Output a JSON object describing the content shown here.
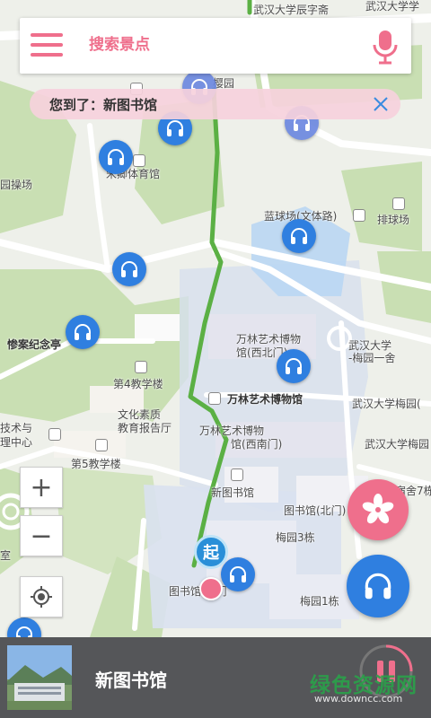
{
  "search": {
    "placeholder": "搜索景点"
  },
  "banner": {
    "text": "您到了：新图书馆"
  },
  "map": {
    "labels": {
      "top1": "武汉大学辰字斋",
      "top2": "武汉大学学",
      "yuan": "樱园",
      "tiyu": "宋卿体育馆",
      "caochang": "园操场",
      "lanqiu": "蓝球场(文体路)",
      "paiqiu": "排球场",
      "jinian": "惨案纪念亭",
      "wanlin1": "万林艺术博物",
      "wanlin1b": "馆(西北门)",
      "wanlin2": "万林艺术博物馆",
      "wanlin3": "万林艺术博物",
      "wanlin3b": "馆(西南门)",
      "mei1": "武汉大学",
      "mei1b": "-梅园一舍",
      "mei2": "武汉大学梅园(",
      "mei3": "武汉大学梅园",
      "jiao4": "第4教学楼",
      "wenhua": "文化素质",
      "wenhuab": "教育报告厅",
      "jishu": "技术与",
      "jishub": "理中心",
      "jiao5": "第5教学楼",
      "xintu": "新图书馆",
      "tubei": "图书馆(北门)",
      "mei3dong": "梅园3栋",
      "tubei2": "图书馆(北门",
      "mei1dong": "梅园1栋",
      "she7": "宿舍7栋",
      "shi": "室"
    },
    "start_marker": "起"
  },
  "bottom": {
    "title": "新图书馆"
  },
  "watermark": {
    "name": "绿色资源网",
    "url": "www.downcc.com"
  },
  "colors": {
    "accent": "#ef6f8c",
    "pin": "#2f7fe0",
    "route": "#5bb044"
  }
}
